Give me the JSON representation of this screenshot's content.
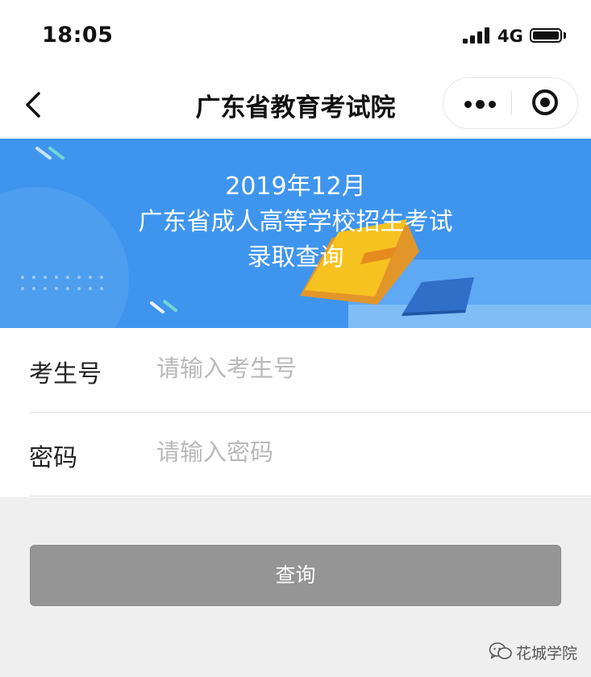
{
  "status_bar": {
    "time": "18:05",
    "network": "4G"
  },
  "nav": {
    "title": "广东省教育考试院"
  },
  "banner": {
    "line1": "2019年12月",
    "line2": "广东省成人高等学校招生考试",
    "line3": "录取查询",
    "colors": {
      "background": "#3f95ee",
      "book": "#f6c21f",
      "card": "#2f6fc8"
    }
  },
  "form": {
    "exam_id": {
      "label": "考生号",
      "placeholder": "请输入考生号",
      "value": ""
    },
    "password": {
      "label": "密码",
      "placeholder": "请输入密码",
      "value": ""
    }
  },
  "submit": {
    "label": "查询"
  },
  "watermark": {
    "text": "花城学院",
    "icon": "wechat-icon"
  }
}
